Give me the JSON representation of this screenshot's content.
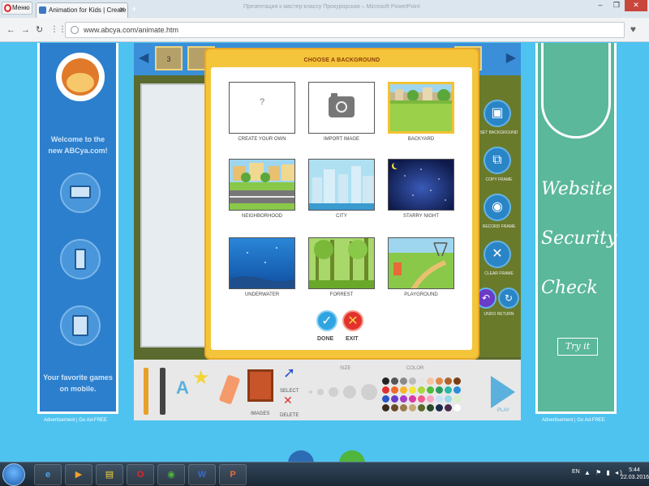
{
  "browser": {
    "menu_label": "Меню",
    "tab_title": "Animation for Kids | Create",
    "window_title": "Презентация к мастер-классу Прокурорская – Microsoft PowerPoint",
    "url": "www.abcya.com/animate.htm",
    "colors": {
      "close_button": "#c9463d",
      "opera": "#e0262b"
    }
  },
  "left_ad": {
    "welcome": "Welcome to the new ABCya.com!",
    "favorite": "Your favorite games on mobile.",
    "ad_label": "Advertisement  |  Go Ad-FREE",
    "icons": [
      "monkey-logo-icon",
      "laptop-icon",
      "phone-icon",
      "tablet-icon"
    ]
  },
  "right_ad": {
    "lines": [
      "Website",
      "Security",
      "Check"
    ],
    "button": "Try it",
    "ad_label": "Advertisement  |  Go Ad-FREE",
    "color": "#5bb89a"
  },
  "game": {
    "frame_number": "3",
    "side_labels": [
      "SET BACKGROUND",
      "COPY FRAME",
      "RECORD FRAME",
      "CLEAR FRAME",
      "UNDO",
      "RETURN"
    ],
    "tools": {
      "images": "IMAGES",
      "select": "SELECT",
      "delete": "DELETE",
      "size": "SIZE",
      "color": "COLOR",
      "play": "PLAY"
    },
    "palette": [
      "#222222",
      "#555555",
      "#8a8a8a",
      "#bbbbbb",
      "#e5e5e5",
      "#f6c5a0",
      "#e08a4a",
      "#b0612b",
      "#7a3d14",
      "#e02f2f",
      "#f06b2a",
      "#f7b52a",
      "#f3e63a",
      "#a8d83a",
      "#4ebc3c",
      "#2a9b5c",
      "#2ab8a8",
      "#2a8fd8",
      "#2a56c8",
      "#6a3ac8",
      "#a63ac8",
      "#d83aa8",
      "#f05a8a",
      "#f7a6c5",
      "#c8e0f8",
      "#98d8e8",
      "#d8f0c8",
      "#3a2a1a",
      "#6b4a2a",
      "#9b7a4a",
      "#c8a878",
      "#5a6a2a",
      "#2a4a2a",
      "#1a2a4a",
      "#4a2a4a",
      "#ffffff"
    ]
  },
  "modal": {
    "title": "CHOOSE A BACKGROUND",
    "options": [
      {
        "label": "CREATE YOUR OWN",
        "icon": "question-mark-icon",
        "selected": false
      },
      {
        "label": "IMPORT IMAGE",
        "icon": "camera-icon",
        "selected": false
      },
      {
        "label": "BACKYARD",
        "selected": true
      },
      {
        "label": "NEIGHBORHOOD",
        "selected": false
      },
      {
        "label": "CITY",
        "selected": false
      },
      {
        "label": "STARRY NIGHT",
        "selected": false
      },
      {
        "label": "UNDERWATER",
        "selected": false
      },
      {
        "label": "FORREST",
        "selected": false
      },
      {
        "label": "PLAYGROUND",
        "selected": false
      }
    ],
    "create_own_mark": "?",
    "done_label": "DONE",
    "exit_label": "EXIT",
    "colors": {
      "frame": "#f4c43b",
      "done": "#2fa4e0",
      "exit": "#e3312f"
    }
  },
  "taskbar": {
    "lang": "EN",
    "time": "5:44",
    "date": "22.03.2016"
  }
}
